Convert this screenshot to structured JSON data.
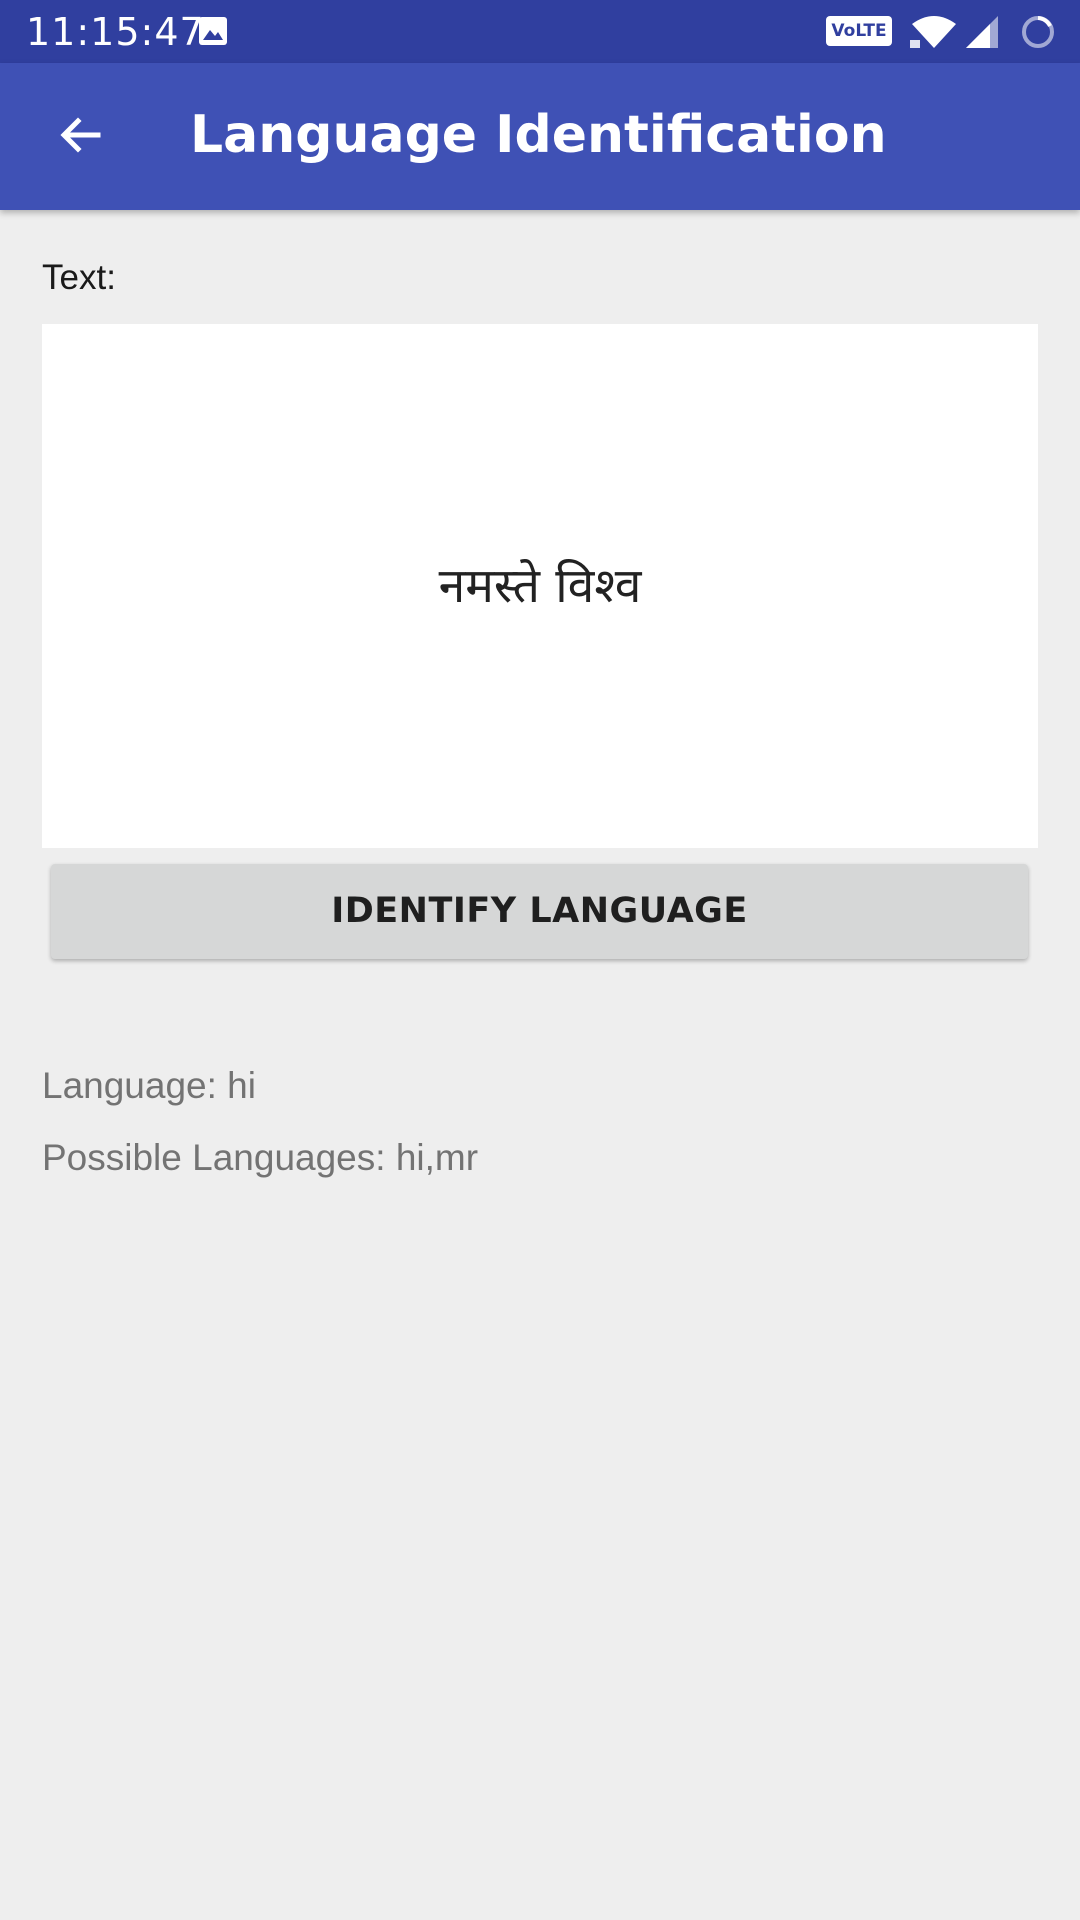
{
  "status_bar": {
    "time": "11:15:47",
    "volte_label": "VoLTE",
    "icons": [
      "gallery-icon",
      "volte-icon",
      "wifi-icon",
      "signal-icon",
      "battery-icon"
    ],
    "background_color": "#303f9f"
  },
  "app_bar": {
    "title": "Language Identification",
    "back_icon": "arrow-back-icon",
    "background_color": "#3f51b5"
  },
  "form": {
    "text_label": "Text:",
    "text_value": "नमस्ते विश्व",
    "button_label": "IDENTIFY LANGUAGE"
  },
  "results": {
    "language": "Language: hi",
    "possible_languages": "Possible Languages: hi,mr"
  }
}
